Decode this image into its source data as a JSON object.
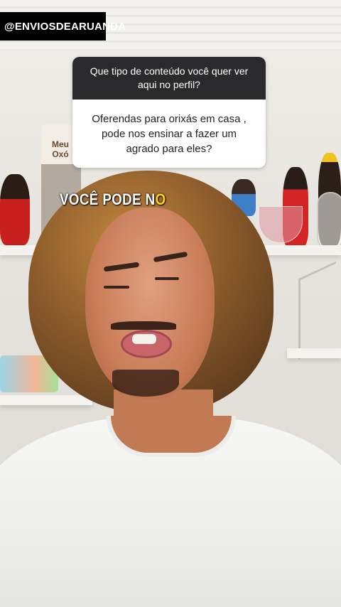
{
  "overlay": {
    "handle": "@ENVIOSDEARUANDA",
    "question_box": {
      "question": "Que tipo de conteúdo você quer ver aqui no perfil?",
      "answer": "Oferendas para orixás em casa , pode nos ensinar a fazer um agrado para eles?"
    },
    "caption": {
      "text": "VOCÊ PODE N",
      "highlight": "O",
      "highlight_color": "#ffd21f"
    }
  },
  "background": {
    "jar_label": "Meu Oxó"
  }
}
